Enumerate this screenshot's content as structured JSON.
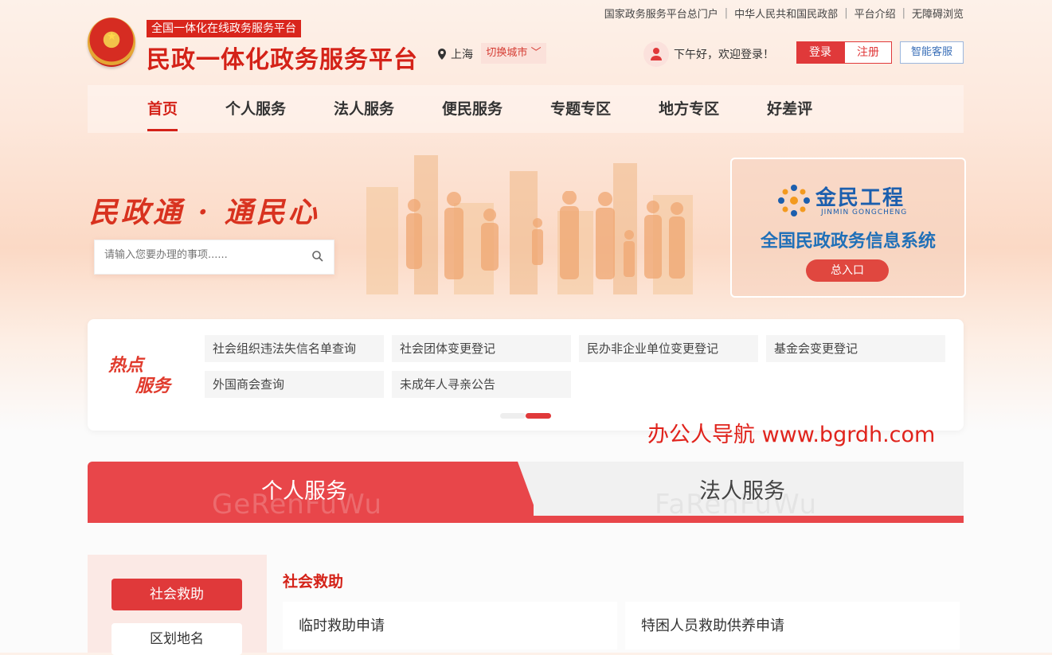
{
  "top_links": [
    "国家政务服务平台总门户",
    "中华人民共和国民政部",
    "平台介绍",
    "无障碍浏览"
  ],
  "header": {
    "badge": "全国一体化在线政务服务平台",
    "title": "民政一体化政务服务平台",
    "location": "上海",
    "switch_city": "切换城市",
    "greeting": "下午好，欢迎登录！",
    "login": "登录",
    "register": "注册",
    "smart_service": "智能客服"
  },
  "nav": [
    {
      "label": "首页",
      "active": true
    },
    {
      "label": "个人服务"
    },
    {
      "label": "法人服务"
    },
    {
      "label": "便民服务"
    },
    {
      "label": "专题专区"
    },
    {
      "label": "地方专区"
    },
    {
      "label": "好差评"
    }
  ],
  "banner": {
    "slogan": "民政通 · 通民心",
    "search_placeholder": "请输入您要办理的事项......",
    "jinmin": {
      "logo_text": "金民工程",
      "logo_sub": "JINMIN GONGCHENG",
      "system": "全国民政政务信息系统",
      "entry": "总入口"
    }
  },
  "hot": {
    "label_1": "热点",
    "label_2": "服务",
    "items": [
      "社会组织违法失信名单查询",
      "社会团体变更登记",
      "民办非企业单位变更登记",
      "基金会变更登记",
      "外国商会查询",
      "未成年人寻亲公告"
    ]
  },
  "watermark": "办公人导航 www.bgrdh.com",
  "tabs": {
    "left": "个人服务",
    "left_ghost": "GeRenFuWu",
    "right": "法人服务",
    "right_ghost": "FaRenFuWu"
  },
  "sidebar": [
    "社会救助",
    "区划地名"
  ],
  "section": {
    "title": "社会救助",
    "items": [
      "临时救助申请",
      "特困人员救助供养申请"
    ]
  },
  "colors": {
    "brand_red": "#d42218",
    "accent": "#e0393a",
    "blue": "#1c5fae"
  }
}
